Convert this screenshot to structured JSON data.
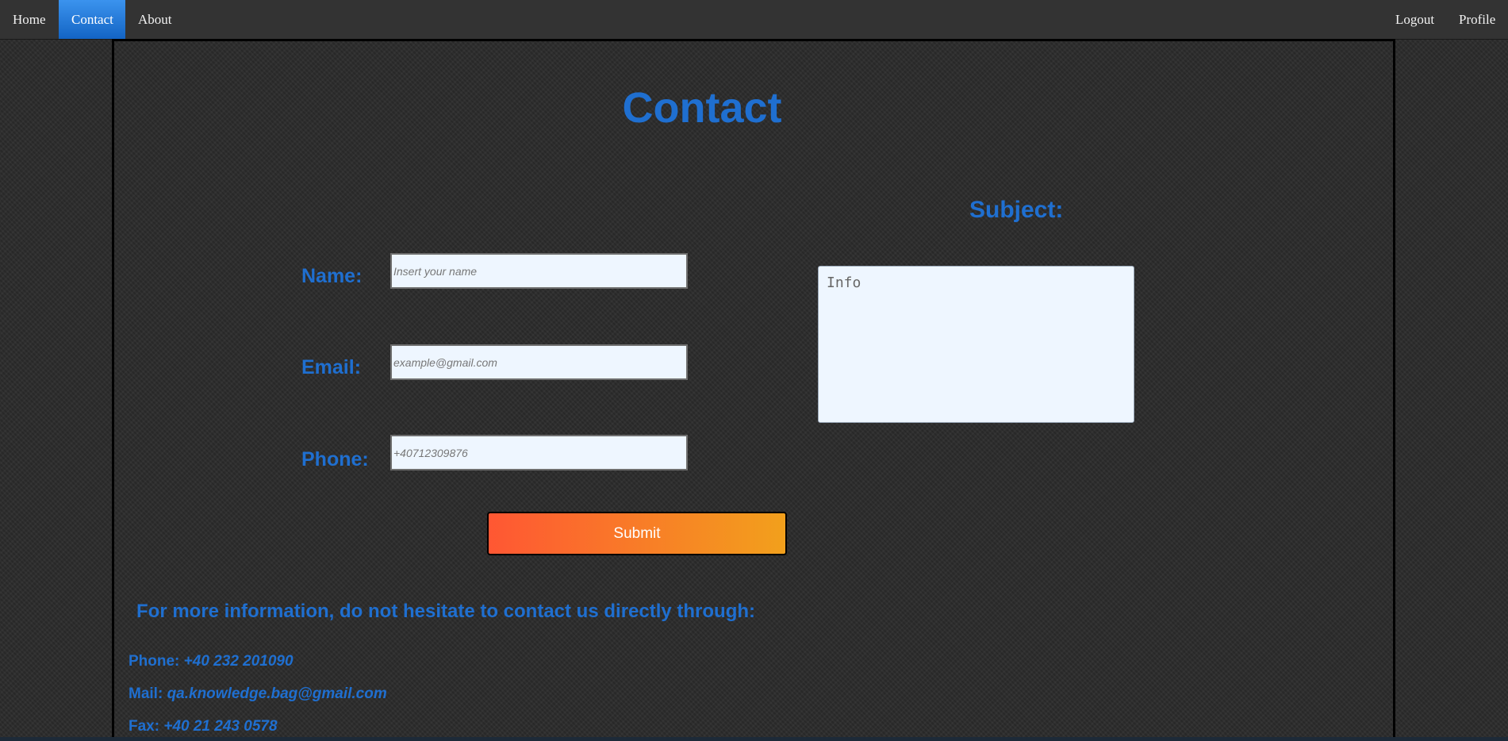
{
  "nav": {
    "home": "Home",
    "contact": "Contact",
    "about": "About",
    "logout": "Logout",
    "profile": "Profile"
  },
  "page_title": "Contact",
  "form": {
    "name_label": "Name:",
    "name_placeholder": "Insert your name",
    "email_label": "Email:",
    "email_placeholder": "example@gmail.com",
    "phone_label": "Phone:",
    "phone_placeholder": "+40712309876",
    "subject_label": "Subject:",
    "subject_placeholder": "Info",
    "submit_label": "Submit"
  },
  "contact_info": {
    "heading": "For more information, do not hesitate to contact us directly through:",
    "phone_label": "Phone:",
    "phone_value": "+40 232 201090",
    "mail_label": "Mail:",
    "mail_value": "qa.knowledge.bag@gmail.com",
    "fax_label": "Fax:",
    "fax_value": "+40 21 243 0578"
  },
  "colors": {
    "accent": "#1f6fd0",
    "nav_bg": "#333333",
    "active_tab": "#2a7fe0",
    "submit_start": "#ff5733",
    "submit_end": "#f2a01c",
    "field_bg": "#eef6ff"
  }
}
